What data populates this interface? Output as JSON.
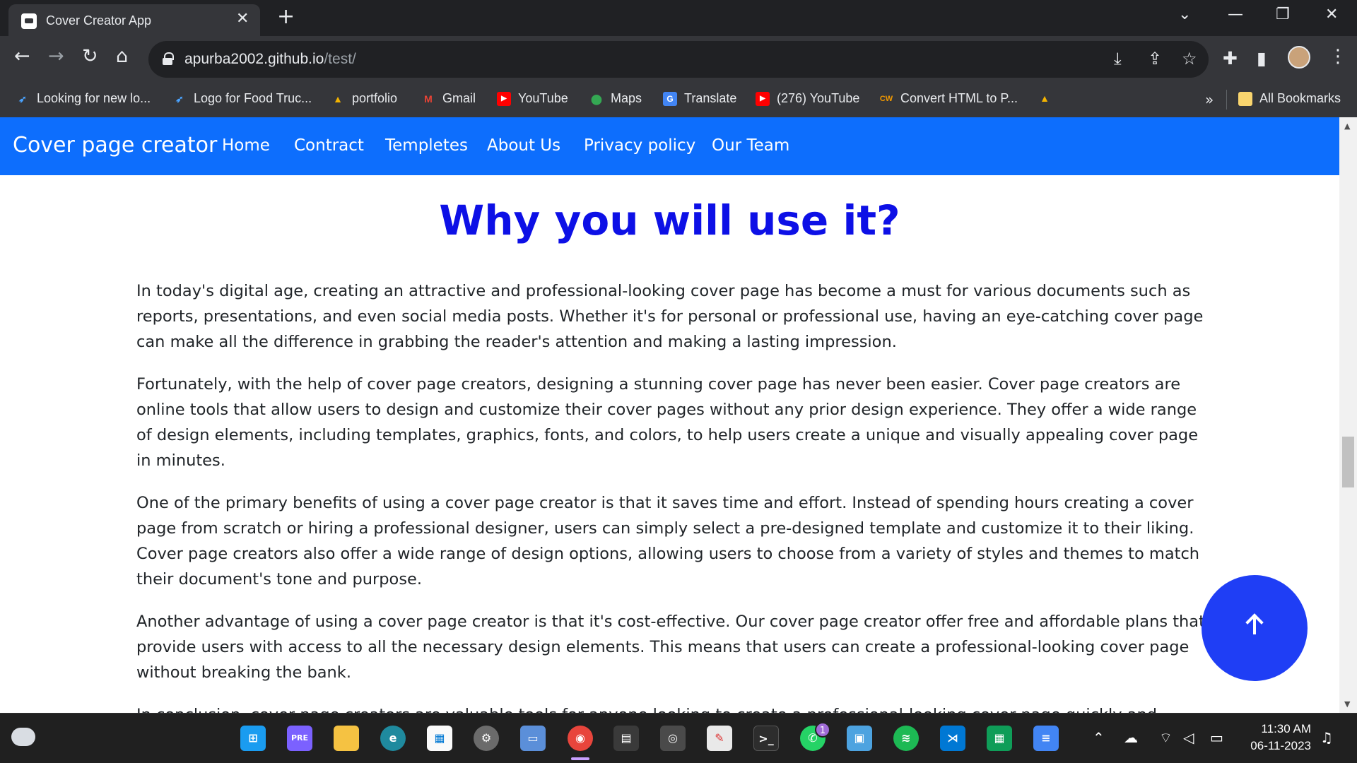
{
  "browser": {
    "tab_title": "Cover Creator App",
    "url_host": "apurba2002.github.io",
    "url_path": "/test/",
    "bookmarks": [
      {
        "label": "Looking for new lo...",
        "icon": "bird-icon",
        "color": "#4aa3ff"
      },
      {
        "label": "Logo for Food Truc...",
        "icon": "bird-icon",
        "color": "#4aa3ff"
      },
      {
        "label": "portfolio",
        "icon": "drive-icon",
        "color": "#f4b400"
      },
      {
        "label": "Gmail",
        "icon": "gmail-icon",
        "color": "#ea4335"
      },
      {
        "label": "YouTube",
        "icon": "youtube-icon",
        "color": "#ff0000"
      },
      {
        "label": "Maps",
        "icon": "maps-icon",
        "color": "#34a853"
      },
      {
        "label": "Translate",
        "icon": "translate-icon",
        "color": "#4285f4"
      },
      {
        "label": "(276) YouTube",
        "icon": "youtube-icon",
        "color": "#ff0000"
      },
      {
        "label": "Convert HTML to P...",
        "icon": "cw-icon",
        "color": "#f29900"
      }
    ],
    "more_label": "»",
    "all_bookmarks": "All Bookmarks"
  },
  "site": {
    "brand": "Cover page creator",
    "nav": [
      "Home",
      "Contract",
      "Templetes",
      "About Us",
      "Privacy policy",
      "Our Team"
    ],
    "heading": "Why you will use it?",
    "paragraphs": [
      "In today's digital age, creating an attractive and professional-looking cover page has become a must for various documents such as reports, presentations, and even social media posts. Whether it's for personal or professional use, having an eye-catching cover page can make all the difference in grabbing the reader's attention and making a lasting impression.",
      "Fortunately, with the help of cover page creators, designing a stunning cover page has never been easier. Cover page creators are online tools that allow users to design and customize their cover pages without any prior design experience. They offer a wide range of design elements, including templates, graphics, fonts, and colors, to help users create a unique and visually appealing cover page in minutes.",
      "One of the primary benefits of using a cover page creator is that it saves time and effort. Instead of spending hours creating a cover page from scratch or hiring a professional designer, users can simply select a pre-designed template and customize it to their liking. Cover page creators also offer a wide range of design options, allowing users to choose from a variety of styles and themes to match their document's tone and purpose.",
      "Another advantage of using a cover page creator is that it's cost-effective. Our cover page creator offer free and affordable plans that provide users with access to all the necessary design elements. This means that users can create a professional-looking cover page without breaking the bank.",
      "In conclusion, cover page creators are valuable tools for anyone looking to create a professional-looking cover page quickly and easily. They"
    ],
    "accent_color": "#0d6efd",
    "heading_color": "#0d10e6"
  },
  "taskbar": {
    "time": "11:30 AM",
    "date": "06-11-2023",
    "whatsapp_badge": "1",
    "apps": [
      "windows-start-icon",
      "copilot-pre-icon",
      "file-explorer-icon",
      "edge-icon",
      "store-icon",
      "settings-icon",
      "photos-icon",
      "chrome-icon",
      "calculator-icon",
      "camera-icon",
      "paint-icon",
      "terminal-icon",
      "whatsapp-icon",
      "control-panel-icon",
      "spotify-icon",
      "vscode-icon",
      "sheets-icon",
      "docs-icon"
    ]
  }
}
